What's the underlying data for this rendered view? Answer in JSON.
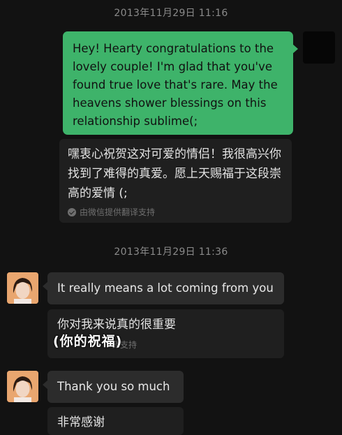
{
  "timestamps": [
    "2013年11月29日 11:16",
    "2013年11月29日 11:36"
  ],
  "messages": {
    "outgoing_text": "Hey! Hearty congratulations to the lovely couple! I'm glad that you've found true love that's rare. May the heavens shower blessings on this relationship sublime(;",
    "outgoing_translation": "嘿衷心祝贺这对可爱的情侣！我很高兴你找到了难得的真爱。愿上天赐福于这段崇高的爱情 (;",
    "translation_note": "由微信提供翻译支持",
    "reply1_text": "It really means a lot coming from you",
    "reply1_translation": "你对我来说真的很重要",
    "reply1_note_partial": "译支持",
    "reply2_text": "Thank you so much",
    "reply2_translation": "非常感谢"
  },
  "overlay_caption": "(你的祝福)",
  "colors": {
    "background": "#121212",
    "outgoing_bubble": "#3eb36a",
    "incoming_bubble": "#2c2c2c",
    "translation_box": "#1f1f1f",
    "timestamp": "#8a8a8a"
  }
}
